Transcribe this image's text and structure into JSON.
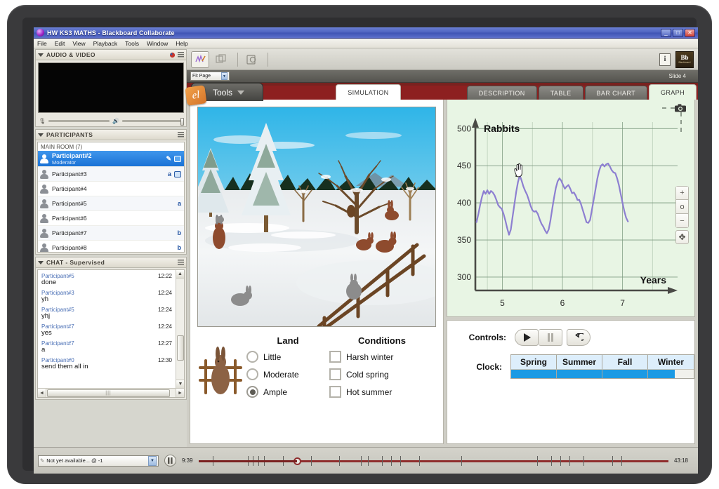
{
  "window": {
    "title": "HW KS3 MATHS - Blackboard Collaborate",
    "app_icon": "collaborate-icon",
    "minimize": "_",
    "maximize": "□",
    "close": "✕",
    "menu": [
      "File",
      "Edit",
      "View",
      "Playback",
      "Tools",
      "Window",
      "Help"
    ]
  },
  "audio_video": {
    "title": "AUDIO & VIDEO",
    "mic_icon": "microphone-icon",
    "speaker_icon": "speaker-icon"
  },
  "participants": {
    "title": "PARTICIPANTS",
    "room_label": "MAIN ROOM",
    "room_count": "(7)",
    "items": [
      {
        "name": "Participant#2",
        "role": "Moderator",
        "selected": true,
        "badges": [
          "pencil-icon",
          "video-icon"
        ]
      },
      {
        "name": "Participant#3",
        "role": "",
        "selected": false,
        "badges": [
          "a",
          "video-icon"
        ]
      },
      {
        "name": "Participant#4",
        "role": "",
        "selected": false,
        "badges": []
      },
      {
        "name": "Participant#5",
        "role": "",
        "selected": false,
        "badges": [
          "a"
        ]
      },
      {
        "name": "Participant#6",
        "role": "",
        "selected": false,
        "badges": []
      },
      {
        "name": "Participant#7",
        "role": "",
        "selected": false,
        "badges": [
          "b"
        ]
      },
      {
        "name": "Participant#8",
        "role": "",
        "selected": false,
        "badges": [
          "b"
        ]
      }
    ]
  },
  "chat": {
    "title": "CHAT - Supervised",
    "messages": [
      {
        "user": "Participant#5",
        "time": "12:22",
        "text": "done"
      },
      {
        "user": "Participant#3",
        "time": "12:24",
        "text": "yh"
      },
      {
        "user": "Participant#5",
        "time": "12:24",
        "text": "yhj"
      },
      {
        "user": "Participant#7",
        "time": "12:24",
        "text": "yes"
      },
      {
        "user": "Participant#7",
        "time": "12:27",
        "text": "a"
      },
      {
        "user": "Participant#0",
        "time": "12:30",
        "text": "send them all in"
      }
    ]
  },
  "content_toolbar": {
    "tools": [
      "whiteboard-pen-icon",
      "copy-slides-icon",
      "load-content-icon"
    ],
    "info_label": "i",
    "logo_text": "Bb",
    "logo_sub": "Blackboard"
  },
  "slide_bar": {
    "zoom_value": "Fit Page",
    "slide_label": "Slide 4"
  },
  "tabs": {
    "tools_button": "Tools",
    "items": [
      {
        "label": "SIMULATION",
        "active": true,
        "style": "white"
      },
      {
        "label": "DESCRIPTION",
        "active": false,
        "style": "grey"
      },
      {
        "label": "TABLE",
        "active": false,
        "style": "grey"
      },
      {
        "label": "BAR CHART",
        "active": false,
        "style": "grey"
      },
      {
        "label": "GRAPH",
        "active": true,
        "style": "green"
      }
    ]
  },
  "simulation": {
    "scene": "winter-snow-field-with-rabbits",
    "land": {
      "heading": "Land",
      "options": [
        {
          "label": "Little",
          "selected": false
        },
        {
          "label": "Moderate",
          "selected": false
        },
        {
          "label": "Ample",
          "selected": true
        }
      ]
    },
    "conditions": {
      "heading": "Conditions",
      "options": [
        {
          "label": "Harsh winter",
          "checked": false
        },
        {
          "label": "Cold spring",
          "checked": false
        },
        {
          "label": "Hot summer",
          "checked": false
        }
      ]
    }
  },
  "graph_panel": {
    "camera_icon": "camera-icon",
    "zoom_in": "+",
    "zoom_reset": "o",
    "zoom_out": "−",
    "pan": "✥"
  },
  "controls": {
    "label": "Controls:",
    "play": "▶",
    "pause": "❚❚",
    "reset": "↺",
    "clock_label": "Clock:",
    "seasons": [
      {
        "name": "Spring",
        "progress": 100
      },
      {
        "name": "Summer",
        "progress": 100
      },
      {
        "name": "Fall",
        "progress": 100
      },
      {
        "name": "Winter",
        "progress": 58
      }
    ]
  },
  "playback": {
    "selector_value": "Not yet available... @ -1",
    "pause_icon": "pause-icon",
    "current_time": "9:39",
    "total_time": "43:18",
    "position_percent": 21
  },
  "chart_data": {
    "type": "line",
    "title": "",
    "xlabel": "Years",
    "ylabel": "Rabbits",
    "xlim": [
      4.55,
      7.8
    ],
    "ylim": [
      282,
      505
    ],
    "xticks": [
      5,
      6,
      7
    ],
    "yticks": [
      300,
      350,
      400,
      450,
      500
    ],
    "grid": true,
    "legend": "none",
    "line_color": "#8d7fd1",
    "background": "#e8f5e4",
    "cursor": "hand-cursor at approx (5.25, 438)",
    "series": [
      {
        "name": "Rabbits",
        "points": [
          [
            4.57,
            374
          ],
          [
            4.6,
            385
          ],
          [
            4.63,
            397
          ],
          [
            4.66,
            408
          ],
          [
            4.69,
            416
          ],
          [
            4.72,
            412
          ],
          [
            4.75,
            417
          ],
          [
            4.78,
            412
          ],
          [
            4.81,
            416
          ],
          [
            4.84,
            414
          ],
          [
            4.87,
            410
          ],
          [
            4.9,
            404
          ],
          [
            4.93,
            397
          ],
          [
            4.96,
            394
          ],
          [
            4.99,
            392
          ],
          [
            5.02,
            385
          ],
          [
            5.05,
            376
          ],
          [
            5.08,
            366
          ],
          [
            5.11,
            357
          ],
          [
            5.14,
            364
          ],
          [
            5.17,
            381
          ],
          [
            5.2,
            398
          ],
          [
            5.23,
            415
          ],
          [
            5.26,
            428
          ],
          [
            5.29,
            437
          ],
          [
            5.32,
            430
          ],
          [
            5.35,
            422
          ],
          [
            5.38,
            416
          ],
          [
            5.41,
            411
          ],
          [
            5.44,
            404
          ],
          [
            5.47,
            396
          ],
          [
            5.5,
            390
          ],
          [
            5.53,
            388
          ],
          [
            5.56,
            389
          ],
          [
            5.59,
            385
          ],
          [
            5.62,
            378
          ],
          [
            5.65,
            372
          ],
          [
            5.68,
            368
          ],
          [
            5.71,
            363
          ],
          [
            5.74,
            359
          ],
          [
            5.77,
            364
          ],
          [
            5.8,
            376
          ],
          [
            5.83,
            392
          ],
          [
            5.86,
            407
          ],
          [
            5.89,
            420
          ],
          [
            5.92,
            429
          ],
          [
            5.95,
            433
          ],
          [
            5.98,
            430
          ],
          [
            6.01,
            424
          ],
          [
            6.04,
            419
          ],
          [
            6.07,
            422
          ],
          [
            6.1,
            424
          ],
          [
            6.13,
            419
          ],
          [
            6.16,
            413
          ],
          [
            6.19,
            414
          ],
          [
            6.22,
            410
          ],
          [
            6.25,
            404
          ],
          [
            6.28,
            404
          ],
          [
            6.31,
            398
          ],
          [
            6.34,
            390
          ],
          [
            6.37,
            382
          ],
          [
            6.4,
            374
          ],
          [
            6.43,
            373
          ],
          [
            6.46,
            377
          ],
          [
            6.49,
            390
          ],
          [
            6.52,
            404
          ],
          [
            6.55,
            418
          ],
          [
            6.58,
            432
          ],
          [
            6.61,
            443
          ],
          [
            6.64,
            450
          ],
          [
            6.67,
            452
          ],
          [
            6.7,
            449
          ],
          [
            6.73,
            452
          ],
          [
            6.76,
            453
          ],
          [
            6.79,
            449
          ],
          [
            6.82,
            444
          ],
          [
            6.85,
            441
          ],
          [
            6.88,
            440
          ],
          [
            6.91,
            433
          ],
          [
            6.94,
            424
          ],
          [
            6.97,
            412
          ],
          [
            7.0,
            400
          ],
          [
            7.03,
            389
          ],
          [
            7.06,
            380
          ],
          [
            7.09,
            375
          ]
        ]
      }
    ]
  }
}
